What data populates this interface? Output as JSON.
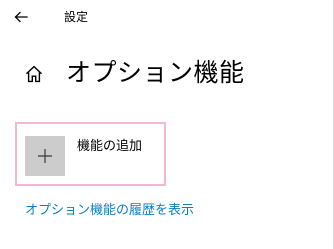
{
  "titlebar": {
    "back_icon": "back-arrow-icon",
    "app_title": "設定"
  },
  "header": {
    "home_icon": "home-icon",
    "title": "オプション機能"
  },
  "add_feature": {
    "icon": "plus-icon",
    "label": "機能の追加"
  },
  "history_link": {
    "label": "オプション機能の履歴を表示"
  },
  "colors": {
    "accent_link": "#0a7fc2",
    "focus_border": "#f0b8d2",
    "tile_background": "#cccccc"
  }
}
